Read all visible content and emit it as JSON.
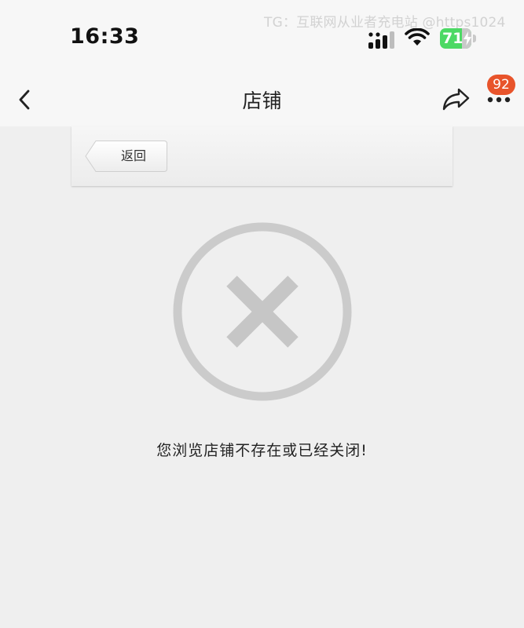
{
  "status_bar": {
    "time": "16:33",
    "battery_level": "71",
    "watermark": "TG：互联网从业者充电站 @https1024"
  },
  "nav": {
    "title": "店铺",
    "badge_count": "92",
    "icons": {
      "back": "chevron-left-icon",
      "share": "share-arrow-icon",
      "more": "more-dots-icon"
    }
  },
  "header": {
    "return_label": "返回"
  },
  "error": {
    "icon": "circle-x-icon",
    "message": "您浏览店铺不存在或已经关闭!"
  },
  "colors": {
    "badge": "#e8542b",
    "battery": "#4cd964",
    "error_icon": "#cccccc"
  }
}
